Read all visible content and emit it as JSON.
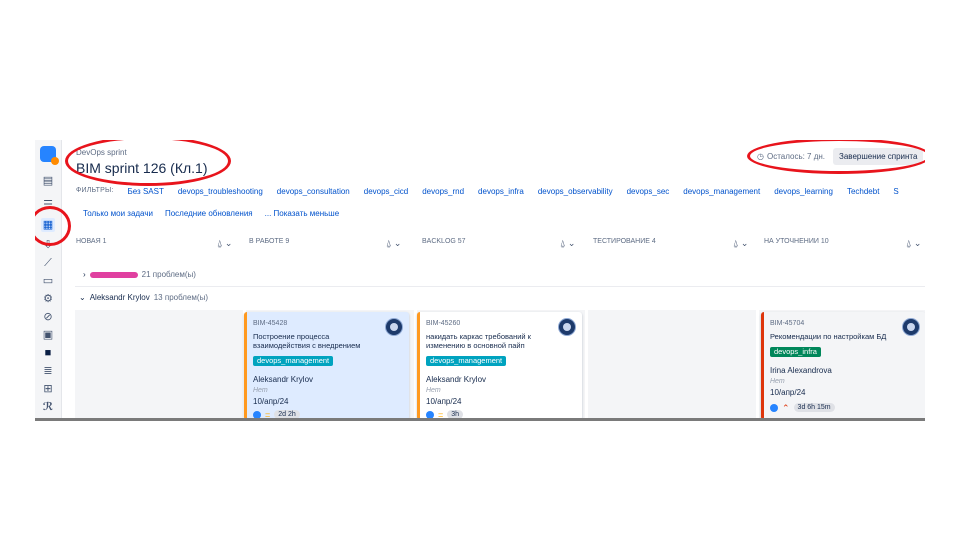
{
  "header": {
    "breadcrumb": "DevOps sprint",
    "title": "BIM sprint 126 (Кл.1)",
    "remaining": "Осталось: 7 дн.",
    "finish_button": "Завершение спринта"
  },
  "filters": {
    "label": "ФИЛЬТРЫ:",
    "items": [
      "Без SAST",
      "devops_troubleshooting",
      "devops_consultation",
      "devops_cicd",
      "devops_rnd",
      "devops_infra",
      "devops_observability",
      "devops_sec",
      "devops_management",
      "devops_learning",
      "Techdebt",
      "S"
    ]
  },
  "quick_filters": [
    "Только мои задачи",
    "Последние обновления",
    "... Показать меньше"
  ],
  "columns": [
    {
      "title": "Новая 1"
    },
    {
      "title": "В работе 9"
    },
    {
      "title": "Backlog 57"
    },
    {
      "title": "Тестирование 4"
    },
    {
      "title": "На уточнении 10"
    }
  ],
  "swimlanes": [
    {
      "count": "21 проблем(ы)"
    },
    {
      "name": "Aleksandr Krylov",
      "count": "13 проблем(ы)"
    }
  ],
  "cards": [
    {
      "key": "BIM-45428",
      "summary": "Построение процесса взаимодействия с внедрением",
      "epic": "devops_management",
      "assignee": "Aleksandr Krylov",
      "none": "Нет",
      "due": "10/апр/24",
      "time": "2d 2h",
      "accent": "#ff991f",
      "bg": "#deebff",
      "epic_color": "#00a3bf"
    },
    {
      "key": "BIM-45260",
      "summary": "накидать каркас требований к изменению в основной пайп",
      "epic": "devops_management",
      "assignee": "Aleksandr Krylov",
      "none": "Нет",
      "due": "10/апр/24",
      "time": "3h",
      "accent": "#ff991f",
      "bg": "#ffffff",
      "epic_color": "#00a3bf"
    },
    {
      "key": "BIM-45704",
      "summary": "Рекомендации по настройкам БД",
      "epic": "devops_infra",
      "assignee": "Irina Alexandrova",
      "none": "Нет",
      "due": "10/апр/24",
      "time": "3d 6h 15m",
      "accent": "#de350b",
      "bg": "#f4f5f7",
      "epic_color": "#00875a"
    }
  ],
  "icons": [
    "app-logo",
    "backlog-icon",
    "board-icon",
    "reports-icon",
    "releases-icon",
    "components-icon",
    "issues-icon",
    "code-icon",
    "settings-icon"
  ]
}
